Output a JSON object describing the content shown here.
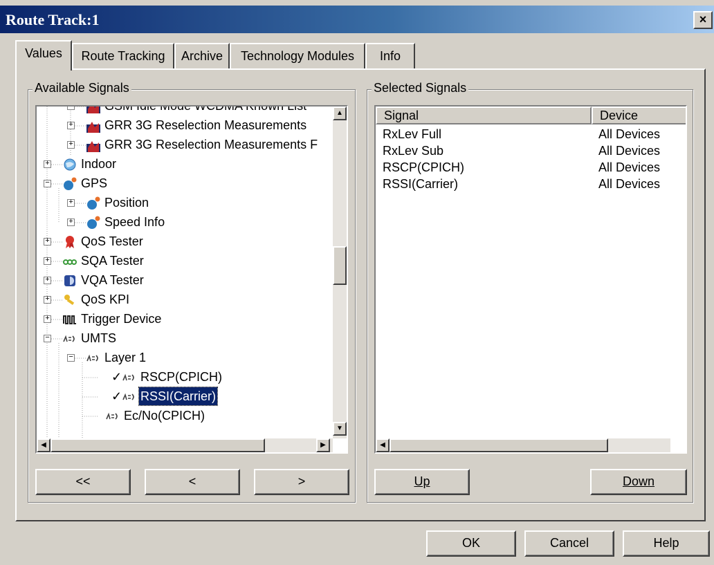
{
  "window": {
    "title": "Route Track:1",
    "close_glyph": "×"
  },
  "tabs": [
    {
      "label": "Values",
      "active": true
    },
    {
      "label": "Route Tracking"
    },
    {
      "label": "Archive"
    },
    {
      "label": "Technology Modules"
    },
    {
      "label": "Info"
    }
  ],
  "available": {
    "legend": "Available Signals",
    "tree": [
      {
        "label": "GSM Idle Mode WCDMA Known List",
        "icon": "chart-icon"
      },
      {
        "label": "GRR 3G Reselection Measurements",
        "icon": "chart-icon"
      },
      {
        "label": "GRR 3G Reselection Measurements F",
        "icon": "chart-icon"
      },
      {
        "label": "Indoor",
        "icon": "globe-icon"
      },
      {
        "label": "GPS",
        "icon": "satellite-icon"
      },
      {
        "label": "Position",
        "icon": "satellite-icon"
      },
      {
        "label": "Speed Info",
        "icon": "satellite-icon"
      },
      {
        "label": "QoS Tester",
        "icon": "ribbon-icon"
      },
      {
        "label": "SQA Tester",
        "icon": "sqa-icon"
      },
      {
        "label": "VQA Tester",
        "icon": "vqa-icon"
      },
      {
        "label": "QoS KPI",
        "icon": "key-icon"
      },
      {
        "label": "Trigger Device",
        "icon": "trigger-icon"
      },
      {
        "label": "UMTS",
        "icon": "umts-icon"
      },
      {
        "label": "Layer 1",
        "icon": "umts-icon"
      },
      {
        "label": "RSCP(CPICH)",
        "icon": "umts-icon",
        "checked": true
      },
      {
        "label": "RSSI(Carrier)",
        "icon": "umts-icon",
        "checked": true,
        "selected": true
      },
      {
        "label": "Ec/No(CPICH)",
        "icon": "umts-icon"
      }
    ],
    "check_glyph": "✓",
    "buttons": {
      "add_all": "<<",
      "add": "<",
      "remove": ">"
    }
  },
  "selected": {
    "legend": "Selected Signals",
    "columns": {
      "signal": "Signal",
      "device": "Device"
    },
    "rows": [
      {
        "signal": "RxLev Full",
        "device": "All Devices"
      },
      {
        "signal": "RxLev Sub",
        "device": "All Devices"
      },
      {
        "signal": "RSCP(CPICH)",
        "device": "All Devices"
      },
      {
        "signal": "RSSI(Carrier)",
        "device": "All Devices"
      }
    ],
    "buttons": {
      "up": "Up",
      "down": "Down"
    }
  },
  "footer": {
    "ok": "OK",
    "cancel": "Cancel",
    "help": "Help"
  },
  "colors": {
    "selection": "#0a246a",
    "title_start": "#0a246a",
    "title_end": "#a6caf0"
  }
}
